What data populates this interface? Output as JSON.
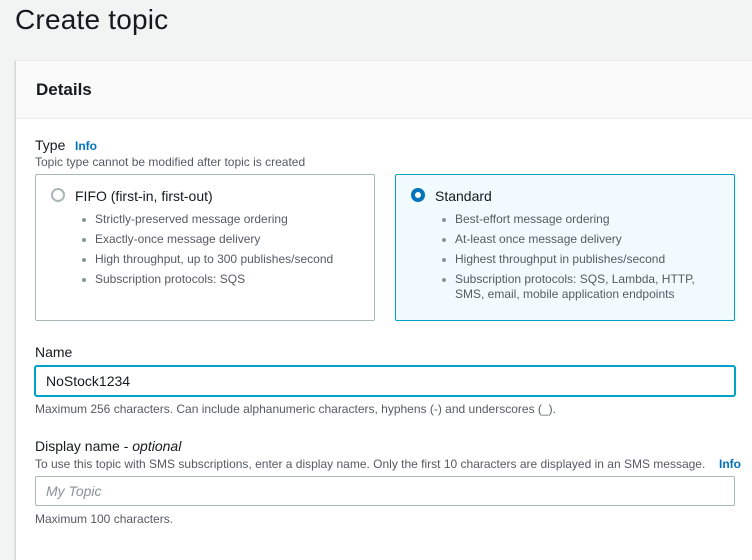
{
  "page": {
    "title": "Create topic"
  },
  "details": {
    "heading": "Details",
    "type": {
      "label": "Type",
      "info": "Info",
      "description": "Topic type cannot be modified after topic is created",
      "options": [
        {
          "title": "FIFO (first-in, first-out)",
          "selected": false,
          "bullets": [
            "Strictly-preserved message ordering",
            "Exactly-once message delivery",
            "High throughput, up to 300 publishes/second",
            "Subscription protocols: SQS"
          ]
        },
        {
          "title": "Standard",
          "selected": true,
          "bullets": [
            "Best-effort message ordering",
            "At-least once message delivery",
            "Highest throughput in publishes/second",
            "Subscription protocols: SQS, Lambda, HTTP, SMS, email, mobile application endpoints"
          ]
        }
      ]
    },
    "name": {
      "label": "Name",
      "value": "NoStock1234",
      "constraint": "Maximum 256 characters. Can include alphanumeric characters, hyphens (-) and underscores (_)."
    },
    "display_name": {
      "label": "Display name - ",
      "optional": "optional",
      "description": "To use this topic with SMS subscriptions, enter a display name. Only the first 10 characters are displayed in an SMS message.",
      "info": "Info",
      "placeholder": "My Topic",
      "value": "",
      "constraint": "Maximum 100 characters."
    }
  },
  "colors": {
    "link": "#0073bb",
    "selected_border": "#00a1c9",
    "selected_bg": "#f1faff"
  }
}
